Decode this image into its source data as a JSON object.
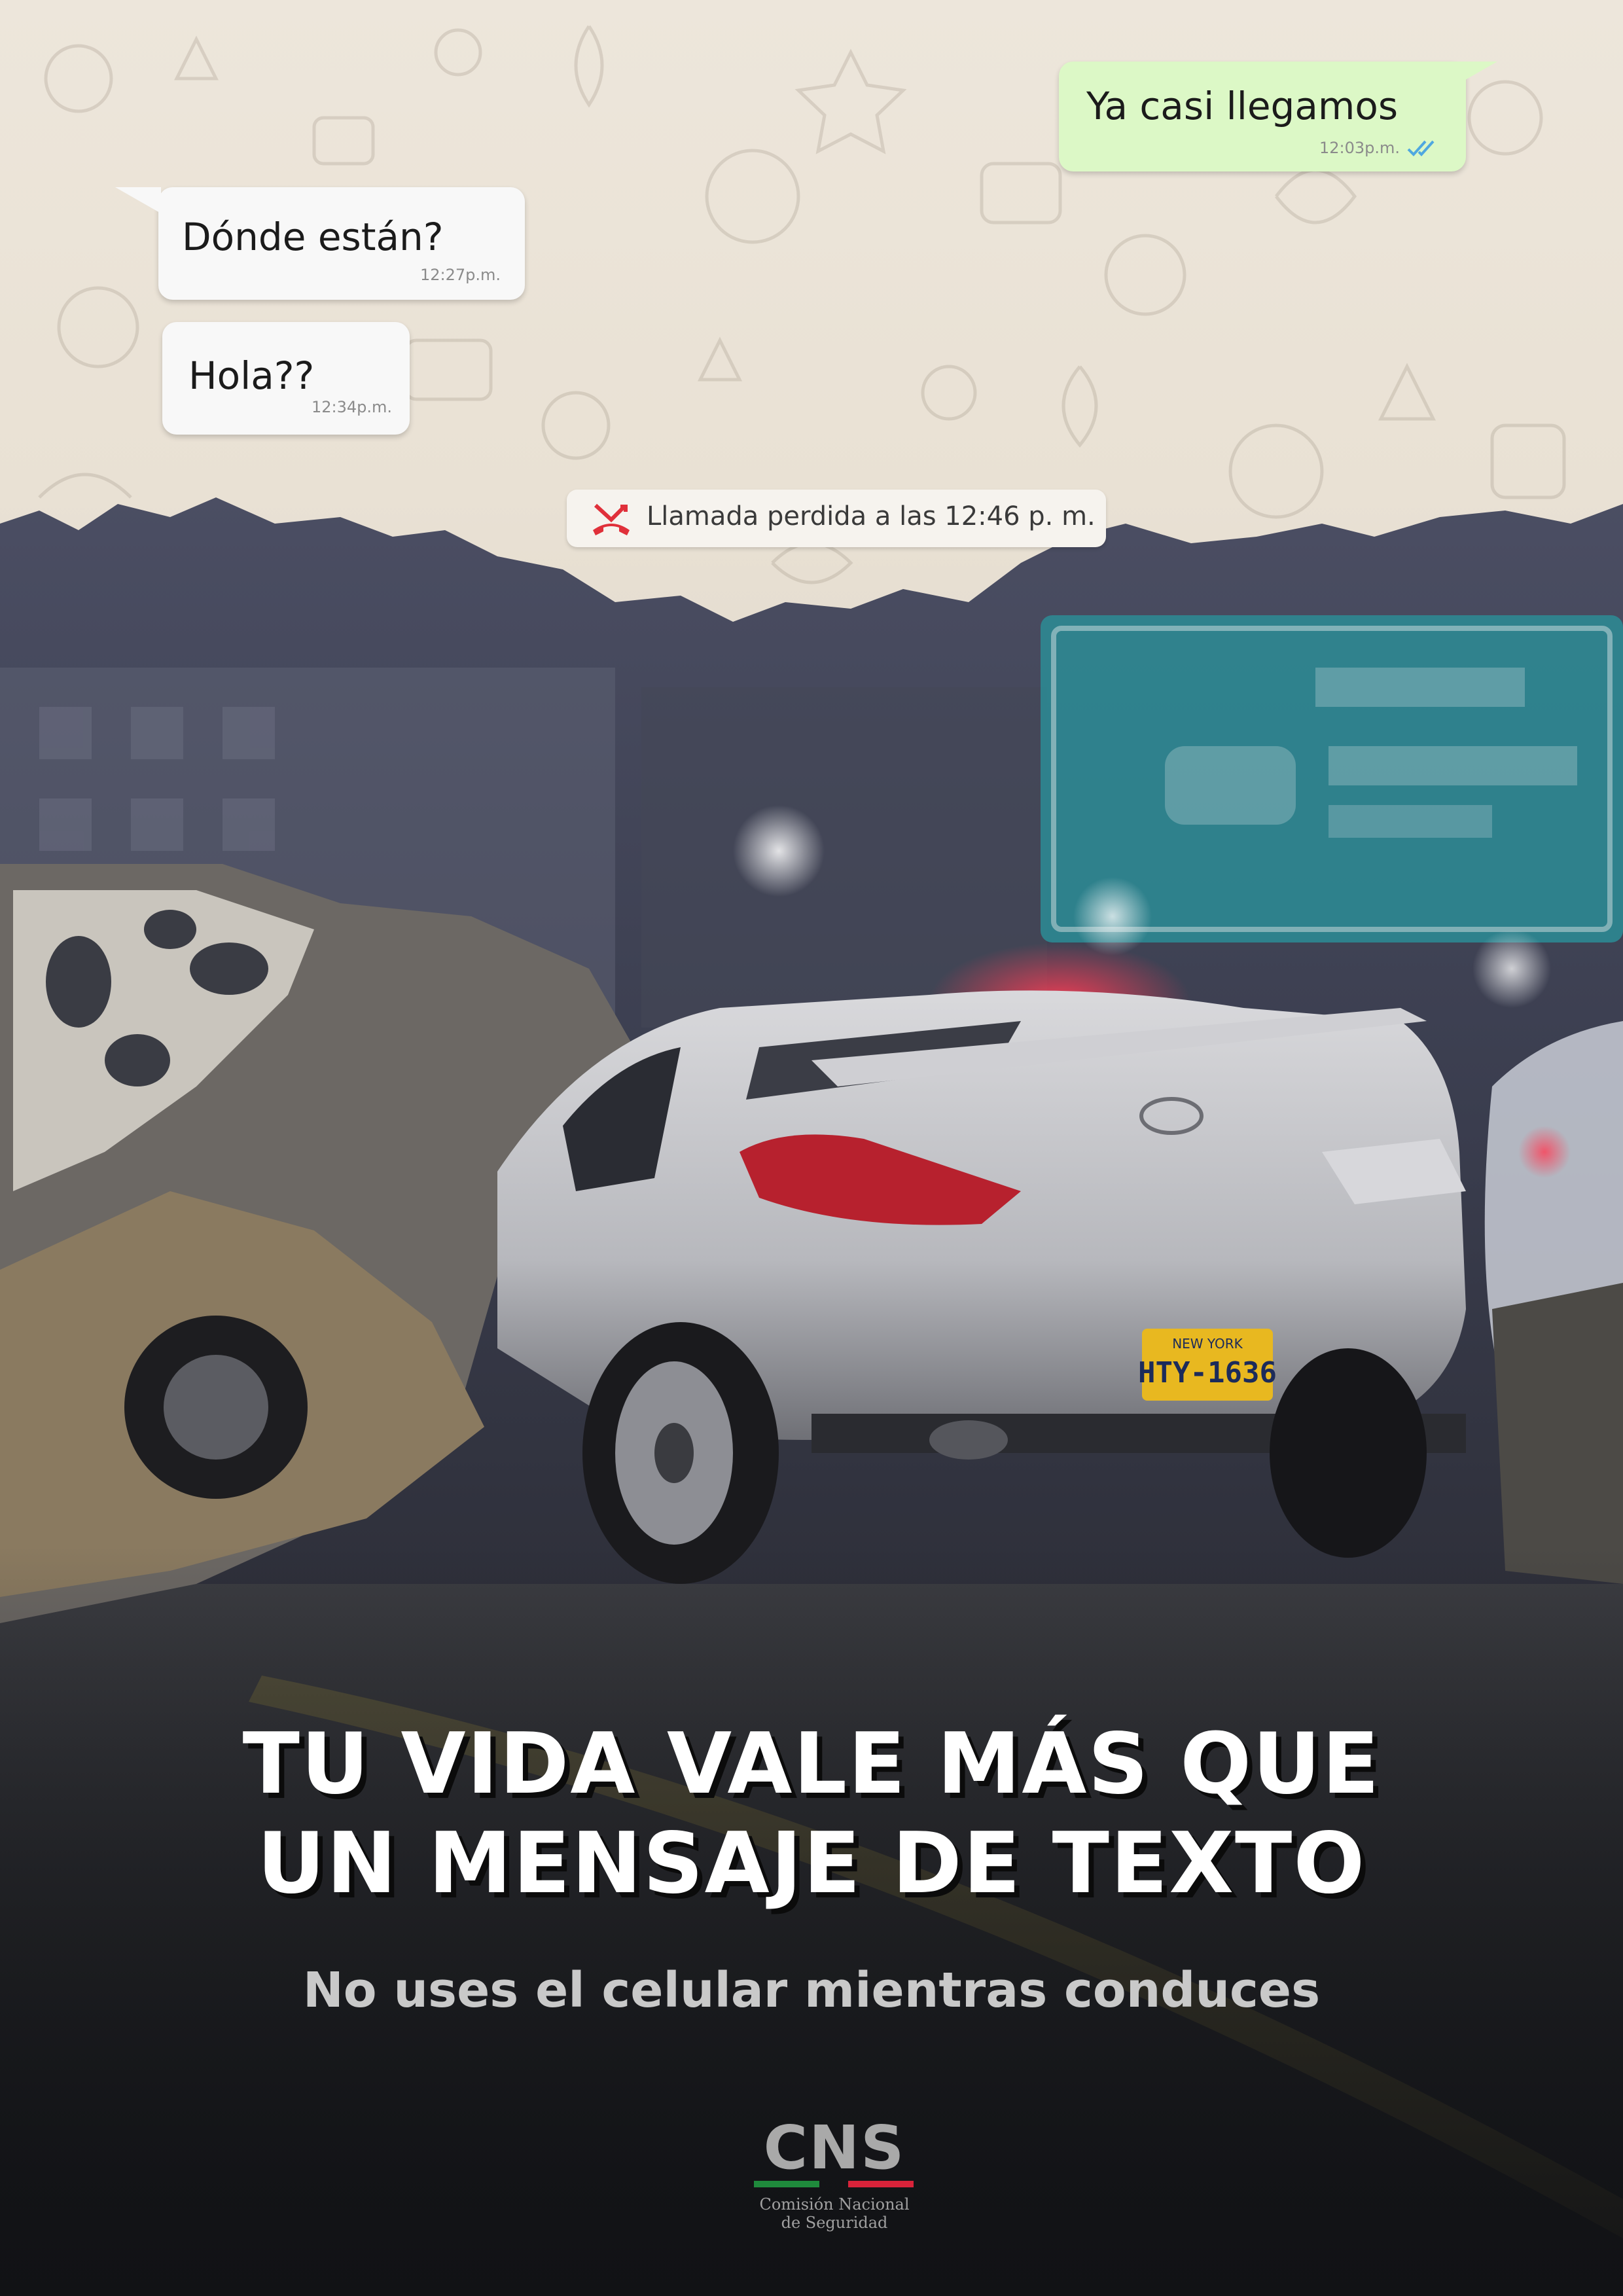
{
  "chat": {
    "messages": [
      {
        "direction": "outgoing",
        "text": "Ya casi llegamos",
        "time": "12:03p.m.",
        "status": "read"
      },
      {
        "direction": "incoming",
        "text": "Dónde están?",
        "time": "12:27p.m."
      },
      {
        "direction": "incoming",
        "text": "Hola??",
        "time": "12:34p.m."
      }
    ],
    "missed_call": {
      "text": "Llamada perdida a las 12:46 p. m.",
      "icon": "missed-call-icon"
    }
  },
  "photo": {
    "license_plate_state": "NEW YORK",
    "license_plate_number": "HTY-1636"
  },
  "campaign": {
    "headline_line1": "TU VIDA VALE MÁS QUE",
    "headline_line2": "UN MENSAJE DE TEXTO",
    "subheadline": "No uses el celular mientras conduces"
  },
  "logo": {
    "abbreviation": "CNS",
    "name_line1": "Comisión Nacional",
    "name_line2": "de Seguridad"
  },
  "colors": {
    "outgoing_bubble": "#dcf8c6",
    "incoming_bubble": "#f8f8f8",
    "chat_background": "#ede6db",
    "read_ticks": "#4fa8e0",
    "missed_call_red": "#e0303a",
    "logo_green": "#1f8a3c",
    "logo_red": "#d8233a"
  }
}
